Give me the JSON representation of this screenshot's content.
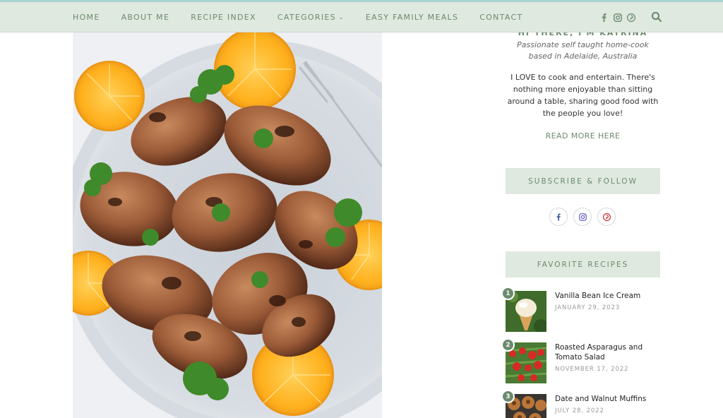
{
  "nav": {
    "items": [
      {
        "label": "HOME"
      },
      {
        "label": "ABOUT ME"
      },
      {
        "label": "RECIPE INDEX"
      },
      {
        "label": "CATEGORIES"
      },
      {
        "label": "EASY FAMILY MEALS"
      },
      {
        "label": "CONTACT"
      }
    ],
    "social_icons": [
      "facebook-icon",
      "instagram-icon",
      "pinterest-icon"
    ],
    "search_icon": "search-icon"
  },
  "hero": {
    "image": "grilled-quail-with-orange-slices-photo"
  },
  "sidebar": {
    "about": {
      "heading": "HI THERE, I'M KATRINA",
      "tagline": "Passionate self taught home-cook based in Adelaide, Australia",
      "body": "I LOVE to cook and entertain. There's nothing more enjoyable than sitting around a table, sharing good food with the people you love!",
      "read_more": "READ MORE HERE"
    },
    "subscribe": {
      "heading": "SUBSCRIBE & FOLLOW",
      "icons": [
        "facebook-icon",
        "instagram-icon",
        "pinterest-icon"
      ]
    },
    "favorites": {
      "heading": "FAVORITE RECIPES",
      "items": [
        {
          "rank": "1",
          "title": "Vanilla Bean Ice Cream",
          "date": "JANUARY 29, 2023"
        },
        {
          "rank": "2",
          "title": "Roasted Asparagus and Tomato Salad",
          "date": "NOVEMBER 17, 2022"
        },
        {
          "rank": "3",
          "title": "Date and Walnut Muffins",
          "date": "JULY 28, 2022"
        }
      ]
    }
  },
  "colors": {
    "accent_green": "#6b8a6e",
    "nav_bg": "#dfe9df",
    "top_line": "#a7d3cf"
  }
}
